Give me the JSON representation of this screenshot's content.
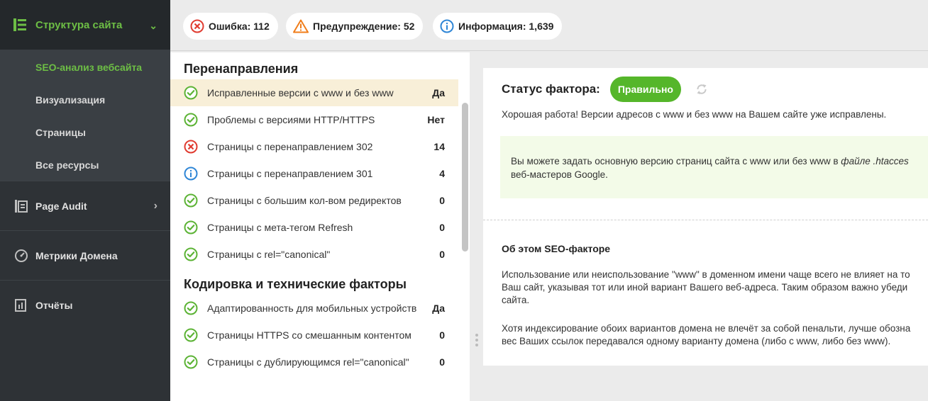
{
  "sidebar": {
    "header": {
      "label": "Структура сайта",
      "icon": "structure-icon",
      "accent": "#6dbe45"
    },
    "subitems": [
      {
        "label": "SEO-анализ вебсайта",
        "active": true
      },
      {
        "label": "Визуализация",
        "active": false
      },
      {
        "label": "Страницы",
        "active": false
      },
      {
        "label": "Все ресурсы",
        "active": false
      }
    ],
    "items": [
      {
        "label": "Page Audit",
        "icon": "page-audit-icon"
      },
      {
        "label": "Метрики Домена",
        "icon": "gauge-icon"
      },
      {
        "label": "Отчёты",
        "icon": "reports-icon"
      }
    ]
  },
  "summary": {
    "errors": "Ошибка: 112",
    "warnings": "Предупреждение: 52",
    "info": "Информация: 1,639"
  },
  "list": {
    "sections": [
      {
        "title": "Перенаправления",
        "rows": [
          {
            "text": "Исправленные версии с www и без www",
            "value": "Да",
            "status": "ok"
          },
          {
            "text": "Проблемы с версиями HTTP/HTTPS",
            "value": "Нет",
            "status": "ok"
          },
          {
            "text": "Страницы с перенаправлением 302",
            "value": "14",
            "status": "error"
          },
          {
            "text": "Страницы с перенаправлением 301",
            "value": "4",
            "status": "info"
          },
          {
            "text": "Страницы с большим кол-вом редиректов",
            "value": "0",
            "status": "ok"
          },
          {
            "text": "Страницы с мета-тегом Refresh",
            "value": "0",
            "status": "ok"
          },
          {
            "text": "Страницы с rel=\"canonical\"",
            "value": "0",
            "status": "ok"
          }
        ]
      },
      {
        "title": "Кодировка и технические факторы",
        "rows": [
          {
            "text": "Адаптированность для мобильных устройств",
            "value": "Да",
            "status": "ok"
          },
          {
            "text": "Страницы HTTPS со смешанным контентом",
            "value": "0",
            "status": "ok"
          },
          {
            "text": "Страницы с дублирующимся rel=\"canonical\"",
            "value": "0",
            "status": "ok"
          }
        ]
      }
    ]
  },
  "detail": {
    "status_label": "Статус фактора:",
    "status_value": "Правильно",
    "description": "Хорошая работа! Версии адресов с www и без www на Вашем сайте уже исправлены.",
    "tip_prefix": "Вы можете задать основную версию страниц сайта с www или без www в ",
    "tip_italic": "файле .htacces",
    "tip_line2": "веб-мастеров Google.",
    "about_title": "Об этом SEO-факторе",
    "para1": [
      "Использование или неиспользование \"www\" в доменном имени чаще всего не влияет на то",
      "Ваш сайт, указывая тот или иной вариант Вашего веб-адреса. Таким образом важно убеди",
      "сайта."
    ],
    "para2": [
      "Хотя индексирование обоих вариантов домена не влечёт за собой пенальти, лучше обозна",
      "вес Ваших ссылок передавался одному варианту домена (либо с www, либо без www)."
    ]
  },
  "colors": {
    "ok": "#5cb335",
    "error": "#e03c31",
    "info": "#2f86d6",
    "warning": "#f07d1a",
    "badge": "#55b62a"
  }
}
